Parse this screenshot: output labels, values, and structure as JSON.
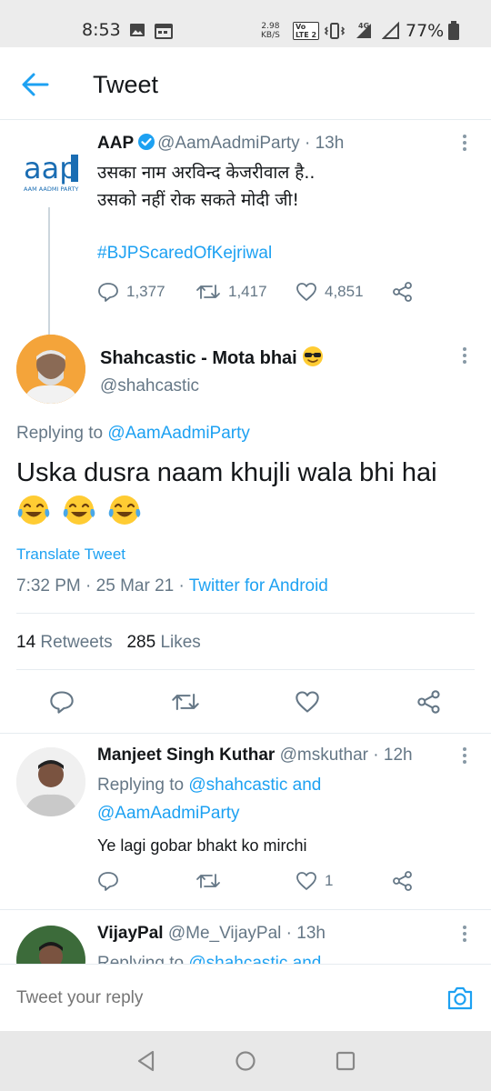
{
  "status_bar": {
    "time": "8:53",
    "net_speed_value": "2.98",
    "net_speed_unit": "KB/S",
    "volte": "Vo",
    "lte": "LTE 2",
    "network": "4G",
    "battery": "77%"
  },
  "header": {
    "title": "Tweet"
  },
  "parent_tweet": {
    "name": "AAP",
    "handle": "@AamAadmiParty",
    "time": "· 13h",
    "logo_text": "aap",
    "logo_subtext": "AAM AADMI PARTY",
    "line1": "उसका नाम अरविन्द केजरीवाल है..",
    "line2": "उसको नहीं रोक सकते मोदी जी!",
    "hashtag": "#BJPScaredOfKejriwal",
    "replies": "1,377",
    "retweets": "1,417",
    "likes": "4,851"
  },
  "main_tweet": {
    "name": "Shahcastic - Mota bhai",
    "handle": "@shahcastic",
    "replying_prefix": "Replying to",
    "replying_to": "@AamAadmiParty",
    "text": "Uska dusra naam khujli wala bhi hai",
    "translate": "Translate Tweet",
    "time": "7:32 PM",
    "date": "· 25 Mar 21 ·",
    "source": "Twitter for Android",
    "retweets_count": "14",
    "retweets_label": "Retweets",
    "likes_count": "285",
    "likes_label": "Likes"
  },
  "replies": [
    {
      "name": "Manjeet Singh Kuthar",
      "handle": "@mskuthar · 12h",
      "replying_prefix": "Replying to",
      "replying_to_1": "@shahcastic and",
      "replying_to_2": "@AamAadmiParty",
      "text": "Ye lagi gobar bhakt ko mirchi",
      "likes": "1"
    },
    {
      "name": "VijayPal",
      "handle": "@Me_VijayPal · 13h",
      "replying_prefix": "Replying to",
      "replying_to_1": "@shahcastic and"
    }
  ],
  "reply_bar": {
    "placeholder": "Tweet your reply"
  },
  "colors": {
    "accent": "#1da1f2",
    "text": "#14171a",
    "secondary": "#657786"
  }
}
